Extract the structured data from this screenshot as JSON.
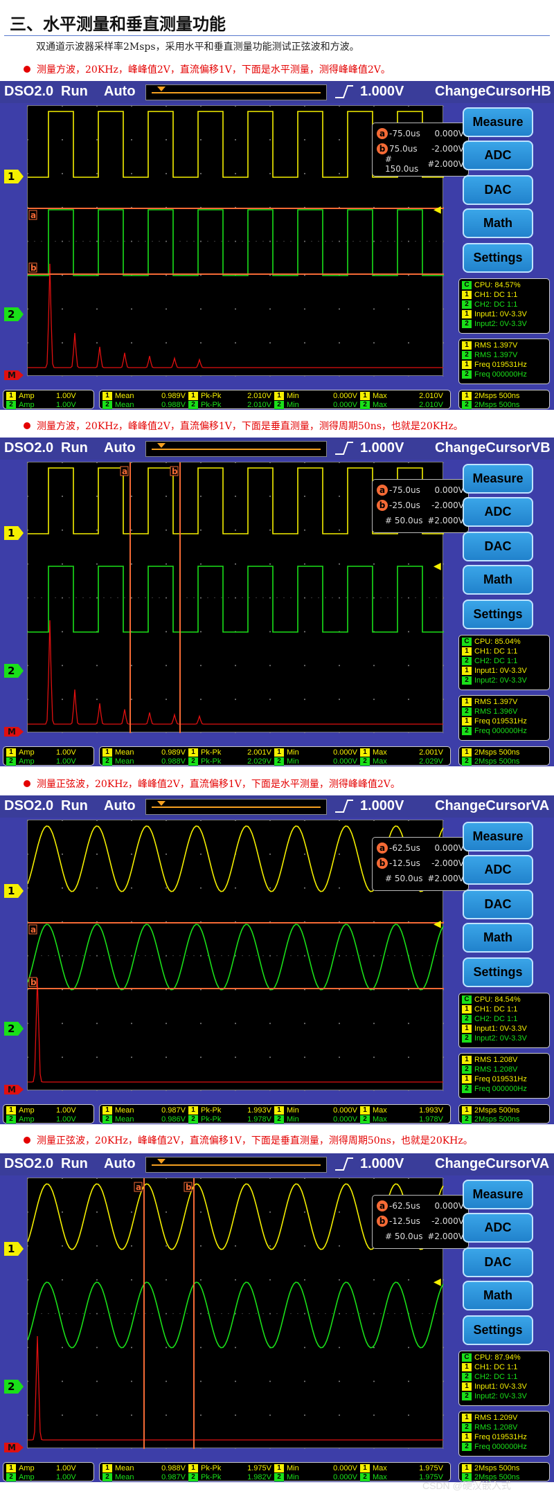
{
  "header": {
    "title": "三、水平测量和垂直测量功能",
    "description": "双通道示波器采样率2Msps，采用水平和垂直测量功能测试正弦波和方波。"
  },
  "notes": [
    "测量方波，20KHz，峰峰值2V，直流偏移1V，下面是水平测量，测得峰峰值2V。",
    "测量方波，20KHz，峰峰值2V，直流偏移1V，下面是垂直测量，测得周期50ns，也就是20KHz。",
    "测量正弦波，20KHz，峰峰值2V，直流偏移1V，下面是水平测量，测得峰峰值2V。",
    "测量正弦波，20KHz，峰峰值2V，直流偏移1V，下面是垂直测量，测得周期50ns，也就是20KHz。"
  ],
  "colors": {
    "ch1": "#f5f000",
    "ch2": "#1ae019",
    "cursor": "#f56a35",
    "fft": "#e01010",
    "panel": "#3d3ea8",
    "button": "#2a95e0"
  },
  "icons": {
    "trigger_edge": "rising-edge-icon",
    "trigger_arrow": "left-arrow-icon"
  },
  "scopes": [
    {
      "app": "DSO2.0",
      "state": "Run",
      "mode": "Auto",
      "trigger_level": "1.000V",
      "cursor_mode": "ChangeCursorHB",
      "waveform": "square",
      "cursor_type": "horizontal",
      "cursors": {
        "a_time": "-75.0us",
        "a_volt": "0.000V",
        "b_time": "75.0us",
        "b_volt": "-2.000V",
        "delta_time": "# 150.0us",
        "delta_volt": "#2.000V"
      },
      "buttons": [
        "Measure",
        "ADC",
        "DAC",
        "Math",
        "Settings"
      ],
      "status": {
        "cpu": "CPU: 84.57%",
        "ch1": "CH1: DC 1:1",
        "ch2": "CH2: DC 1:1",
        "input1": "Input1: 0V-3.3V",
        "input2": "Input2: 0V-3.3V"
      },
      "rms": {
        "rms1": "RMS  1.397V",
        "rms2": "RMS  1.397V",
        "freq1": "Freq  019531Hz",
        "freq2": "Freq  000000Hz"
      },
      "amp": [
        "Amp",
        "1.00V",
        "Amp",
        "1.00V"
      ],
      "meas1": {
        "mean": "0.989V",
        "pkpk": "2.010V",
        "min": "0.000V",
        "max": "2.010V"
      },
      "meas2": {
        "mean": "0.988V",
        "pkpk": "2.010V",
        "min": "0.000V",
        "max": "2.010V"
      },
      "rate": [
        "2Msps 500ns",
        "2Msps 500ns"
      ]
    },
    {
      "app": "DSO2.0",
      "state": "Run",
      "mode": "Auto",
      "trigger_level": "1.000V",
      "cursor_mode": "ChangeCursorVB",
      "waveform": "square",
      "cursor_type": "vertical",
      "cursors": {
        "a_time": "-75.0us",
        "a_volt": "0.000V",
        "b_time": "-25.0us",
        "b_volt": "-2.000V",
        "delta_time": "# 50.0us",
        "delta_volt": "#2.000V"
      },
      "buttons": [
        "Measure",
        "ADC",
        "DAC",
        "Math",
        "Settings"
      ],
      "status": {
        "cpu": "CPU: 85.04%",
        "ch1": "CH1: DC 1:1",
        "ch2": "CH2: DC 1:1",
        "input1": "Input1: 0V-3.3V",
        "input2": "Input2: 0V-3.3V"
      },
      "rms": {
        "rms1": "RMS  1.397V",
        "rms2": "RMS  1.396V",
        "freq1": "Freq  019531Hz",
        "freq2": "Freq  000000Hz"
      },
      "amp": [
        "Amp",
        "1.00V",
        "Amp",
        "1.00V"
      ],
      "meas1": {
        "mean": "0.989V",
        "pkpk": "2.001V",
        "min": "0.000V",
        "max": "2.001V"
      },
      "meas2": {
        "mean": "0.988V",
        "pkpk": "2.029V",
        "min": "0.000V",
        "max": "2.029V"
      },
      "rate": [
        "2Msps 500ns",
        "2Msps 500ns"
      ]
    },
    {
      "app": "DSO2.0",
      "state": "Run",
      "mode": "Auto",
      "trigger_level": "1.000V",
      "cursor_mode": "ChangeCursorVA",
      "waveform": "sine",
      "cursor_type": "horizontal",
      "cursors": {
        "a_time": "-62.5us",
        "a_volt": "0.000V",
        "b_time": "-12.5us",
        "b_volt": "-2.000V",
        "delta_time": "# 50.0us",
        "delta_volt": "#2.000V"
      },
      "buttons": [
        "Measure",
        "ADC",
        "DAC",
        "Math",
        "Settings"
      ],
      "status": {
        "cpu": "CPU: 84.54%",
        "ch1": "CH1: DC 1:1",
        "ch2": "CH2: DC 1:1",
        "input1": "Input1: 0V-3.3V",
        "input2": "Input2: 0V-3.3V"
      },
      "rms": {
        "rms1": "RMS  1.208V",
        "rms2": "RMS  1.208V",
        "freq1": "Freq  019531Hz",
        "freq2": "Freq  000000Hz"
      },
      "amp": [
        "Amp",
        "1.00V",
        "Amp",
        "1.00V"
      ],
      "meas1": {
        "mean": "0.987V",
        "pkpk": "1.993V",
        "min": "0.000V",
        "max": "1.993V"
      },
      "meas2": {
        "mean": "0.986V",
        "pkpk": "1.978V",
        "min": "0.000V",
        "max": "1.978V"
      },
      "rate": [
        "2Msps 500ns",
        "2Msps 500ns"
      ]
    },
    {
      "app": "DSO2.0",
      "state": "Run",
      "mode": "Auto",
      "trigger_level": "1.000V",
      "cursor_mode": "ChangeCursorVA",
      "waveform": "sine",
      "cursor_type": "vertical",
      "cursors": {
        "a_time": "-62.5us",
        "a_volt": "0.000V",
        "b_time": "-12.5us",
        "b_volt": "-2.000V",
        "delta_time": "# 50.0us",
        "delta_volt": "#2.000V"
      },
      "buttons": [
        "Measure",
        "ADC",
        "DAC",
        "Math",
        "Settings"
      ],
      "status": {
        "cpu": "CPU: 87.94%",
        "ch1": "CH1: DC 1:1",
        "ch2": "CH2: DC 1:1",
        "input1": "Input1: 0V-3.3V",
        "input2": "Input2: 0V-3.3V"
      },
      "rms": {
        "rms1": "RMS  1.209V",
        "rms2": "RMS  1.208V",
        "freq1": "Freq  019531Hz",
        "freq2": "Freq  000000Hz"
      },
      "amp": [
        "Amp",
        "1.00V",
        "Amp",
        "1.00V"
      ],
      "meas1": {
        "mean": "0.988V",
        "pkpk": "1.975V",
        "min": "0.000V",
        "max": "1.975V"
      },
      "meas2": {
        "mean": "0.987V",
        "pkpk": "1.982V",
        "min": "0.000V",
        "max": "1.975V"
      },
      "rate": [
        "2Msps 500ns",
        "2Msps 500ns"
      ]
    }
  ],
  "watermark": "CSDN @硬汉嵌入式"
}
